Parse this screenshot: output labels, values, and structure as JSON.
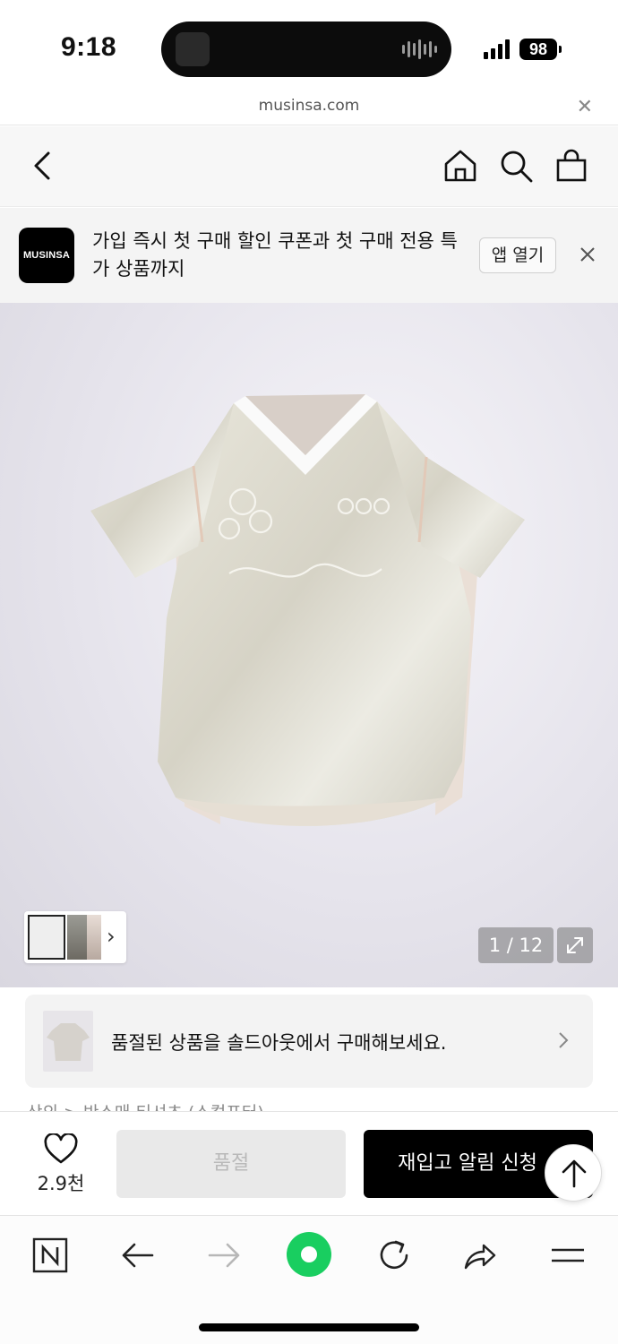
{
  "status_bar": {
    "time": "9:18",
    "battery": "98"
  },
  "browser": {
    "url": "musinsa.com",
    "close_icon": "close-icon"
  },
  "header": {
    "back_icon": "chevron-left-icon",
    "home_icon": "home-icon",
    "search_icon": "search-icon",
    "cart_icon": "shopping-bag-icon"
  },
  "app_banner": {
    "logo_text": "MUSINSA",
    "message": "가입 즉시 첫 구매 할인 쿠폰과 첫 구매 전용 특가 상품까지",
    "open_label": "앱 열기"
  },
  "gallery": {
    "counter": "1 / 12",
    "expand_icon": "expand-icon",
    "thumb_arrow": "›"
  },
  "soldout_card": {
    "message": "품절된 상품을 솔드아웃에서 구매해보세요."
  },
  "breadcrumb": "상의 > 반소매 티셔츠 (스컬프터)",
  "buy_bar": {
    "like_count": "2.9천",
    "soldout_label": "품절",
    "restock_label": "재입고 알림 신청"
  },
  "colors": {
    "accent": "#000000",
    "disabled_bg": "#e9e9e9",
    "disabled_text": "#b9b9b9",
    "toolbar_green": "#19ce60"
  }
}
